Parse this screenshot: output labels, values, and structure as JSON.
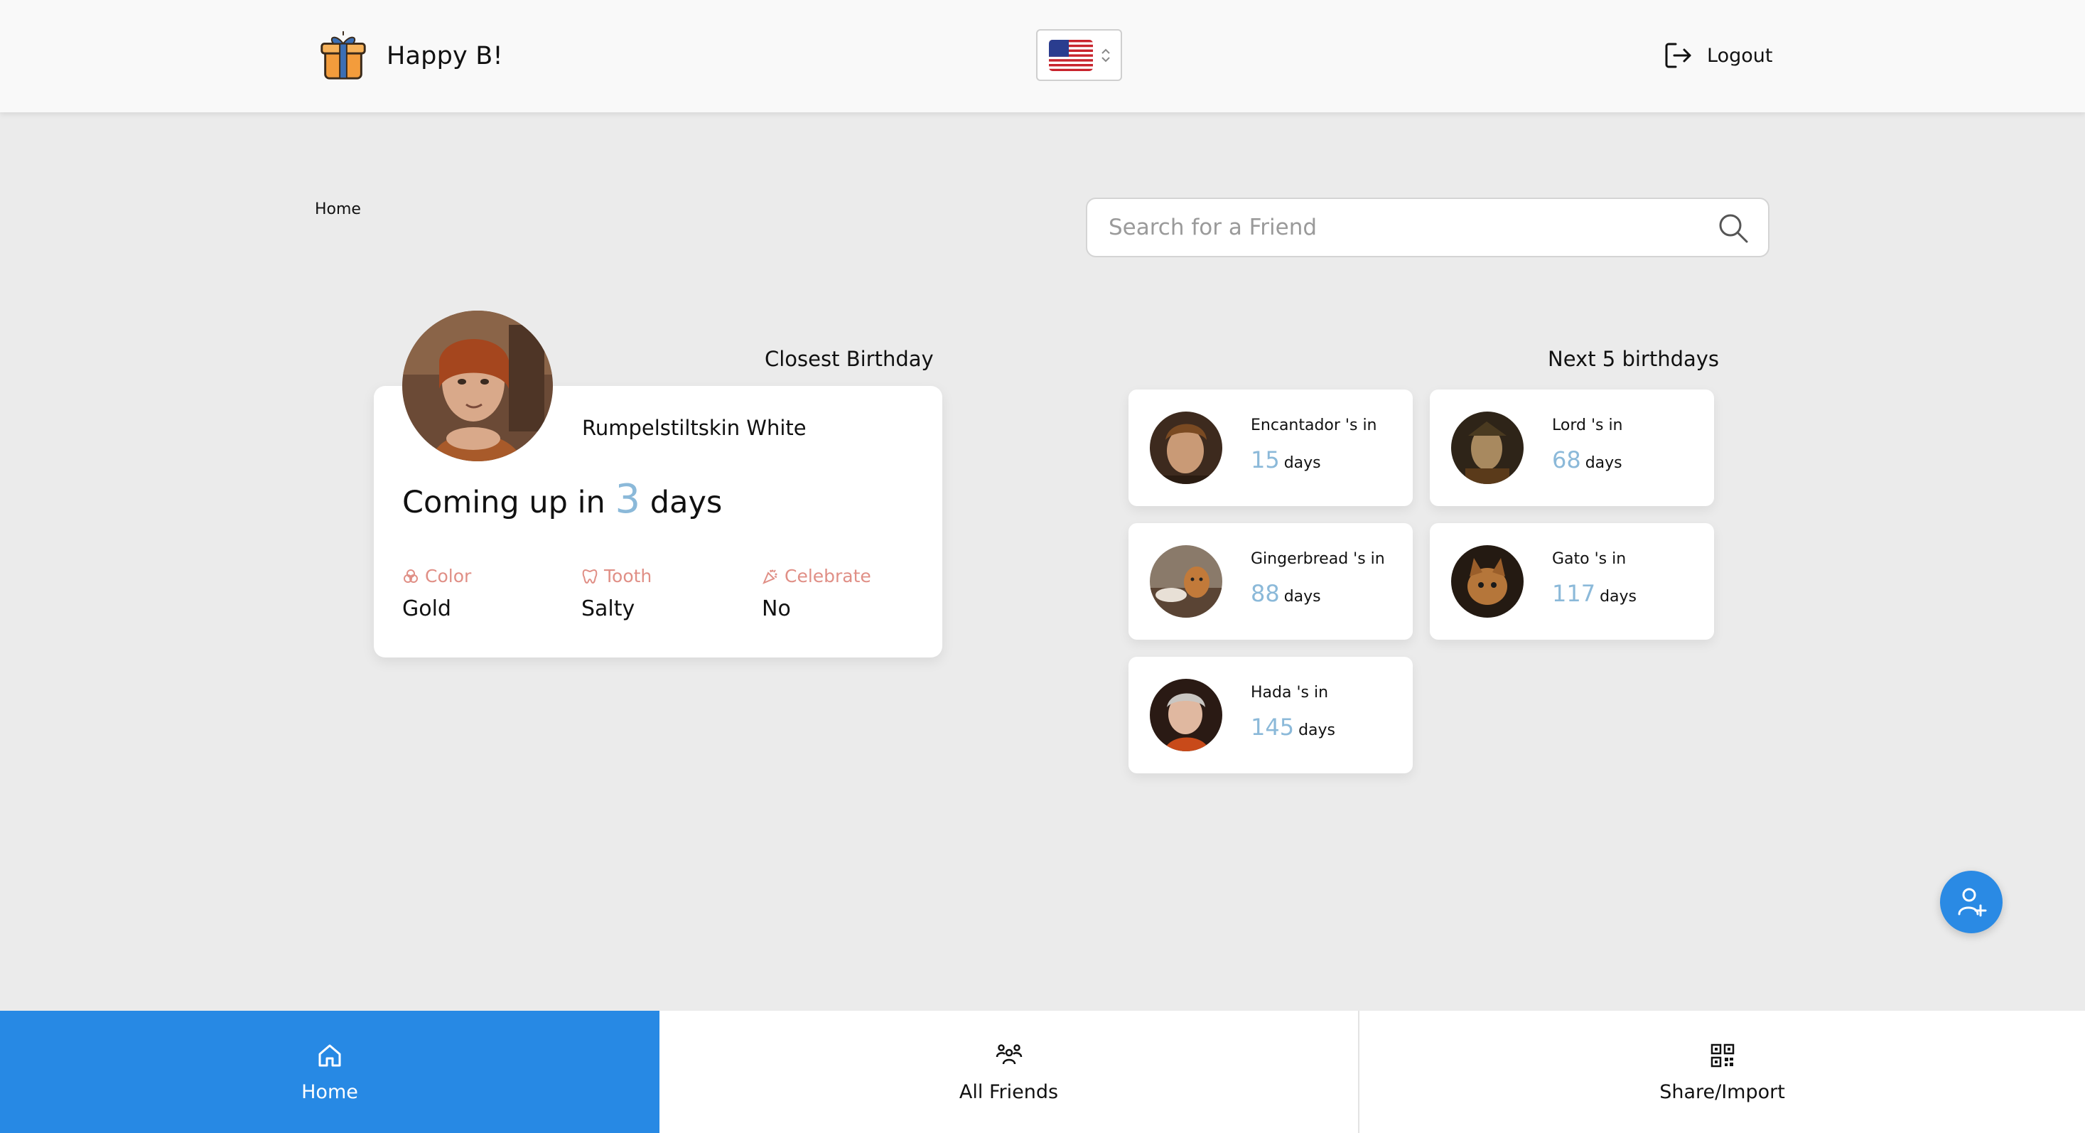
{
  "header": {
    "app_name": "Happy B!",
    "language_icon": "us-flag-icon",
    "logout_label": "Logout"
  },
  "breadcrumb": "Home",
  "search": {
    "placeholder": "Search for a Friend"
  },
  "closest": {
    "title": "Closest Birthday",
    "name": "Rumpelstiltskin White",
    "coming_prefix": "Coming up in",
    "days": "3",
    "days_suffix": "days",
    "prefs": [
      {
        "label": "Color",
        "value": "Gold",
        "icon": "palette-icon"
      },
      {
        "label": "Tooth",
        "value": "Salty",
        "icon": "tooth-icon"
      },
      {
        "label": "Celebrate",
        "value": "No",
        "icon": "confetti-icon"
      }
    ]
  },
  "next": {
    "title": "Next 5 birthdays",
    "items": [
      {
        "name": "Encantador 's in",
        "days": "15",
        "unit": "days"
      },
      {
        "name": "Lord 's in",
        "days": "68",
        "unit": "days"
      },
      {
        "name": "Gingerbread 's in",
        "days": "88",
        "unit": "days"
      },
      {
        "name": "Gato 's in",
        "days": "117",
        "unit": "days"
      },
      {
        "name": "Hada 's in",
        "days": "145",
        "unit": "days"
      }
    ]
  },
  "nav": {
    "home": "Home",
    "friends": "All Friends",
    "share": "Share/Import"
  },
  "colors": {
    "accent": "#2789e4",
    "days_number": "#8bb9d9",
    "pref_label": "#e08f86"
  }
}
